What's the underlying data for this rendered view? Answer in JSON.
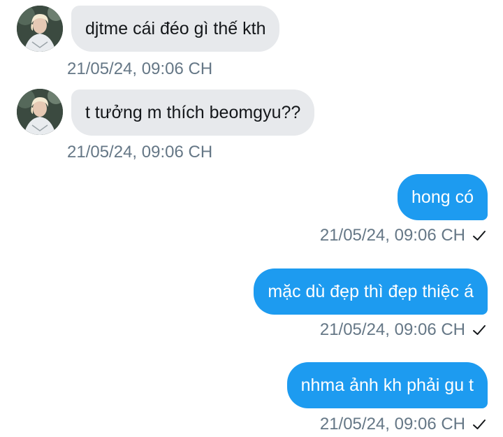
{
  "conversation": {
    "messages": [
      {
        "direction": "in",
        "text": "djtme cái đéo gì thế kth",
        "timestamp": "21/05/24, 09:06 CH"
      },
      {
        "direction": "in",
        "text": "t tưởng m thích beomgyu??",
        "timestamp": "21/05/24, 09:06 CH"
      },
      {
        "direction": "out",
        "text": "hong có",
        "timestamp": "21/05/24, 09:06 CH",
        "status_icon": "checkmark-icon"
      },
      {
        "direction": "out",
        "text": "mặc dù đẹp thì đẹp thiệc á",
        "timestamp": "21/05/24, 09:06 CH",
        "status_icon": "checkmark-icon"
      },
      {
        "direction": "out",
        "text": "nhma ảnh kh phải gu t",
        "timestamp": "21/05/24, 09:06 CH",
        "status_icon": "checkmark-icon"
      }
    ]
  },
  "colors": {
    "incoming_bubble": "#e7e9ec",
    "outgoing_bubble": "#1d9bf0",
    "timestamp_text": "#657786"
  }
}
